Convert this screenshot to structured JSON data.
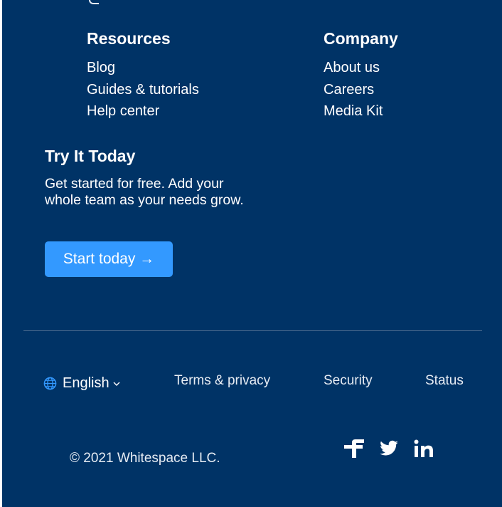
{
  "resources": {
    "heading": "Resources",
    "links": [
      "Blog",
      "Guides & tutorials",
      "Help center"
    ]
  },
  "company": {
    "heading": "Company",
    "links": [
      "About us",
      "Careers",
      "Media Kit"
    ]
  },
  "cta": {
    "heading": "Try It Today",
    "body": "Get started for free. Add your whole team as your needs grow.",
    "button_label": "Start today →"
  },
  "bottom": {
    "language": "English",
    "terms": "Terms & privacy",
    "security": "Security",
    "status": "Status"
  },
  "copyright": "© 2021 Whitespace LLC.",
  "social": {
    "icons": [
      "facebook-icon",
      "twitter-icon",
      "linkedin-icon"
    ]
  },
  "colors": {
    "background": "#003366",
    "button": "#3399ff",
    "divider": "#4d6c8f",
    "globe": "#3399ff"
  }
}
